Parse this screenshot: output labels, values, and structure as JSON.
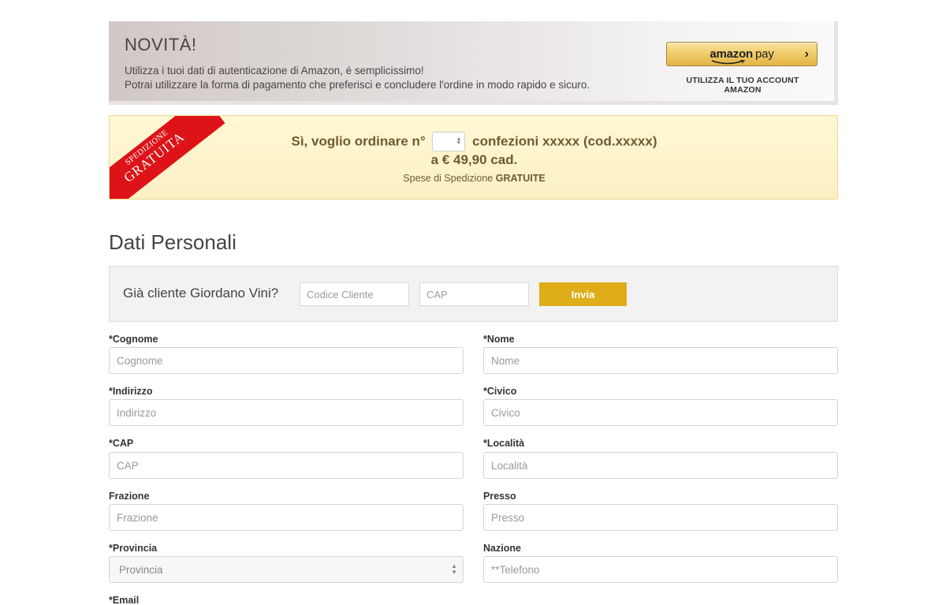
{
  "amazon_banner": {
    "title": "NOVITÀ!",
    "text_line1": "Utilizza i tuoi dati di autenticazione di Amazon, é semplicissimo!",
    "text_line2": "Potrai utilizzare la forma di pagamento che preferisci e concludere l'ordine in modo rapido e sicuro.",
    "button_logo_bold": "amazon",
    "button_logo_pay": "pay",
    "button_chevron": "›",
    "caption": "UTILIZZA IL TUO ACCOUNT AMAZON"
  },
  "order": {
    "ribbon_line1": "SPEDIZIONE",
    "ribbon_line2": "GRATUITA",
    "prefix": "Sì, voglio ordinare n°",
    "quantity": "",
    "suffix": "confezioni xxxxx (cod.xxxxx)",
    "price_line": "a € 49,90 cad.",
    "shipping_prefix": "Spese di Spedizione",
    "shipping_bold": "GRATUITE"
  },
  "section_title": "Dati Personali",
  "client": {
    "label": "Già cliente Giordano Vini?",
    "code_placeholder": "Codice Cliente",
    "cap_placeholder": "CAP",
    "submit_label": "Invia"
  },
  "form": {
    "cognome": {
      "label": "*Cognome",
      "placeholder": "Cognome"
    },
    "nome": {
      "label": "*Nome",
      "placeholder": "Nome"
    },
    "indirizzo": {
      "label": "*Indirizzo",
      "placeholder": "Indirizzo"
    },
    "civico": {
      "label": "*Civico",
      "placeholder": "Civico"
    },
    "cap": {
      "label": "*CAP",
      "placeholder": "CAP"
    },
    "localita": {
      "label": "*Località",
      "placeholder": "Località"
    },
    "frazione": {
      "label": "Frazione",
      "placeholder": "Frazione"
    },
    "presso": {
      "label": "Presso",
      "placeholder": "Presso"
    },
    "provincia": {
      "label": "*Provincia",
      "value": "Provincia"
    },
    "nazione": {
      "label": "Nazione",
      "placeholder": "**Telefono"
    },
    "email": {
      "label": "*Email"
    }
  },
  "colors": {
    "accent_gold": "#dfad1a",
    "ribbon_red": "#dd1318",
    "order_text": "#6e5b32"
  }
}
